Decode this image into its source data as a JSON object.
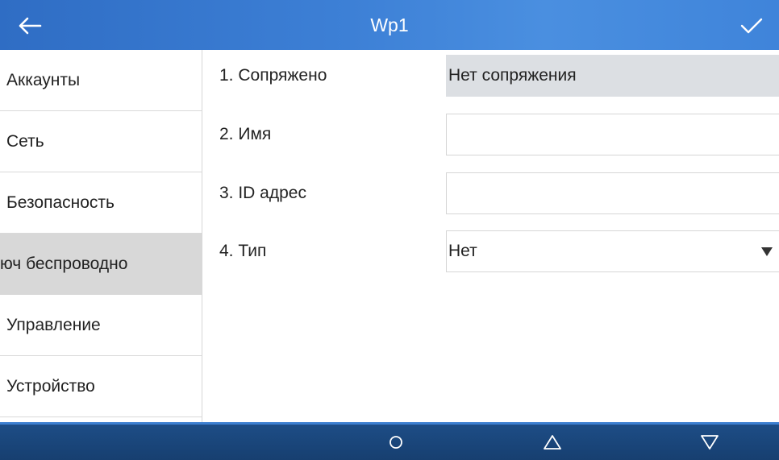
{
  "header": {
    "title": "Wp1",
    "back_icon": "arrow-left-icon",
    "confirm_icon": "checkmark-icon"
  },
  "sidebar": {
    "items": [
      {
        "label": "Аккаунты",
        "active": false
      },
      {
        "label": "Сеть",
        "active": false
      },
      {
        "label": "Безопасность",
        "active": false
      },
      {
        "label": "юч беспроводно",
        "active": true
      },
      {
        "label": "Управление",
        "active": false
      },
      {
        "label": "Устройство",
        "active": false
      }
    ]
  },
  "form": {
    "fields": [
      {
        "label": "1.  Сопряжено",
        "value": "Нет сопряжения",
        "kind": "readonly"
      },
      {
        "label": "2.  Имя",
        "value": "",
        "kind": "text"
      },
      {
        "label": "3.  ID адрес",
        "value": "",
        "kind": "text"
      },
      {
        "label": "4.  Тип",
        "value": "Нет",
        "kind": "select"
      }
    ]
  },
  "navbar": {
    "icons": [
      "circle-home-icon",
      "triangle-up-icon",
      "triangle-down-icon"
    ]
  },
  "colors": {
    "header": "#3d80d6",
    "footer": "#1b4679",
    "active_item": "#d8d8d8",
    "readonly_field": "#dcdfe3"
  }
}
